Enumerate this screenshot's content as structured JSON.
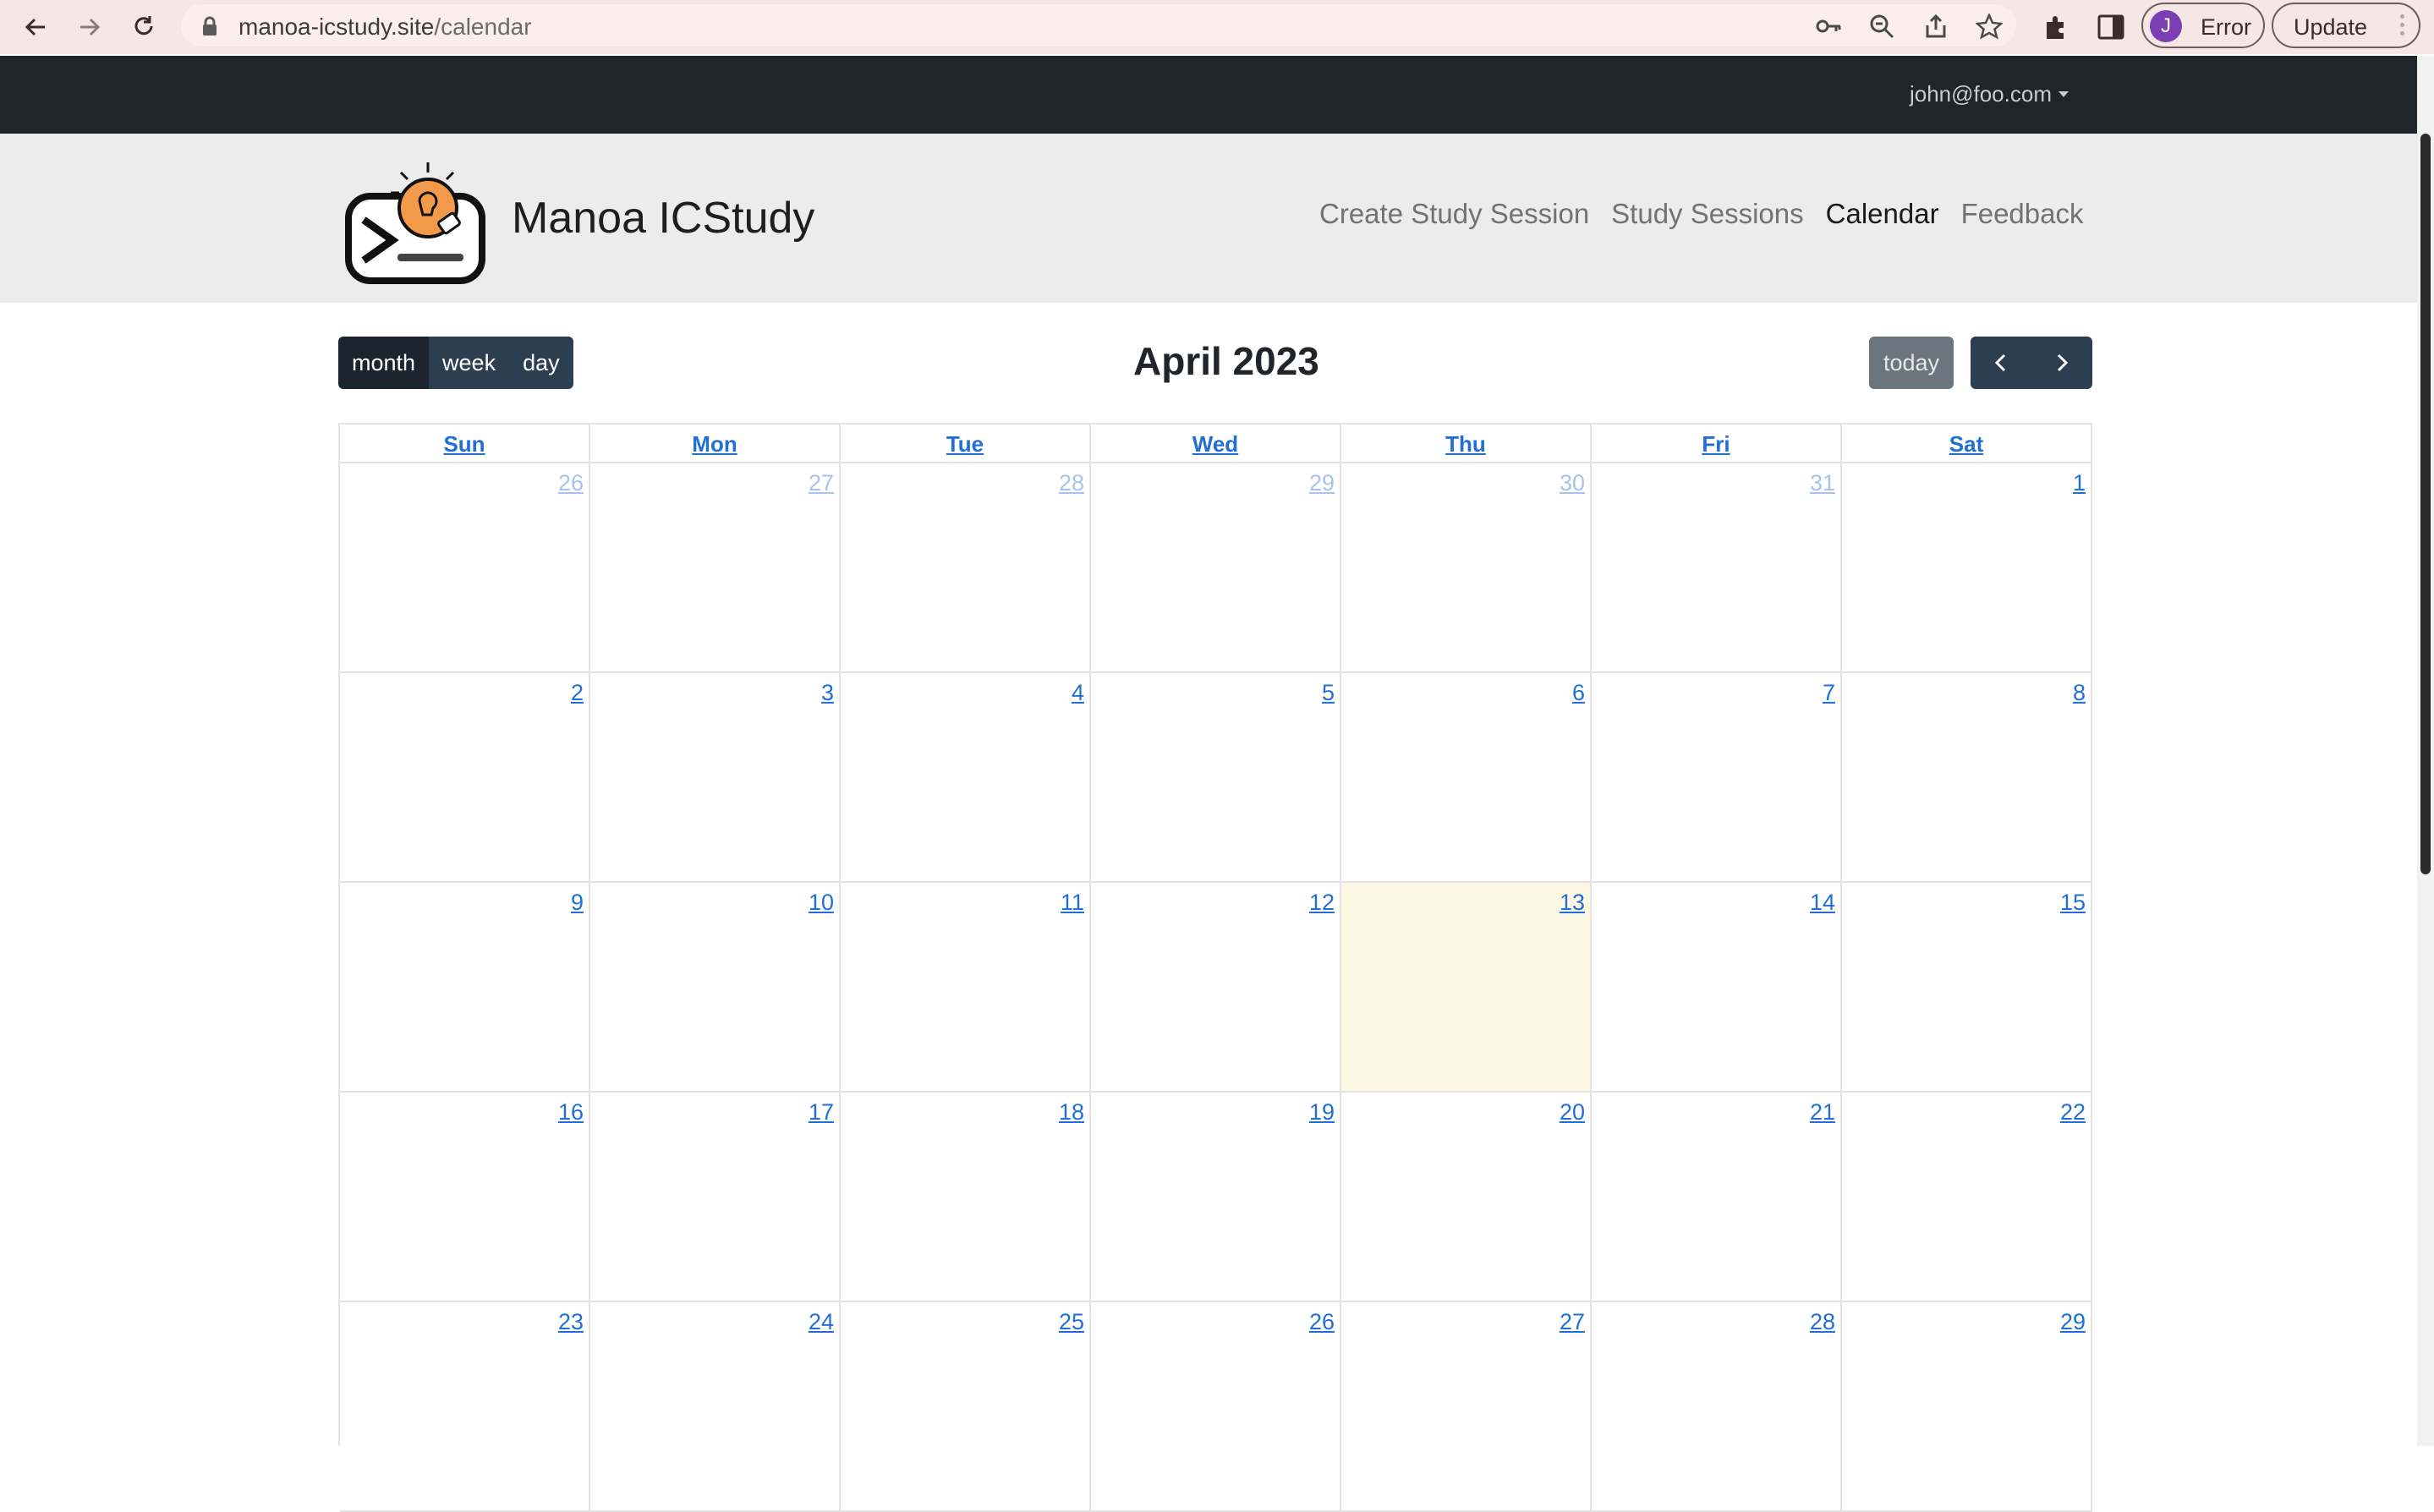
{
  "browser": {
    "url_host": "manoa-icstudy.site",
    "url_path": "/calendar",
    "profile_initial": "J",
    "profile_status": "Error",
    "update_label": "Update",
    "icons": [
      "back-arrow-icon",
      "forward-arrow-icon",
      "reload-icon",
      "lock-icon",
      "key-icon",
      "zoom-icon",
      "share-icon",
      "star-icon",
      "puzzle-icon",
      "side-panel-icon",
      "kebab-menu-icon"
    ]
  },
  "topbar": {
    "user_email": "john@foo.com"
  },
  "header": {
    "brand": "Manoa ICStudy",
    "nav": [
      {
        "label": "Create Study Session",
        "active": false
      },
      {
        "label": "Study Sessions",
        "active": false
      },
      {
        "label": "Calendar",
        "active": true
      },
      {
        "label": "Feedback",
        "active": false
      }
    ]
  },
  "calendar": {
    "title": "April 2023",
    "views": [
      "month",
      "week",
      "day"
    ],
    "active_view": "month",
    "today_label": "today",
    "weekdays": [
      "Sun",
      "Mon",
      "Tue",
      "Wed",
      "Thu",
      "Fri",
      "Sat"
    ],
    "weeks": [
      [
        "26",
        "27",
        "28",
        "29",
        "30",
        "31",
        "1"
      ],
      [
        "2",
        "3",
        "4",
        "5",
        "6",
        "7",
        "8"
      ],
      [
        "9",
        "10",
        "11",
        "12",
        "13",
        "14",
        "15"
      ],
      [
        "16",
        "17",
        "18",
        "19",
        "20",
        "21",
        "22"
      ],
      [
        "23",
        "24",
        "25",
        "26",
        "27",
        "28",
        "29"
      ]
    ],
    "other_month_cells": [
      [
        0,
        0
      ],
      [
        0,
        1
      ],
      [
        0,
        2
      ],
      [
        0,
        3
      ],
      [
        0,
        4
      ],
      [
        0,
        5
      ]
    ],
    "today_cell": [
      2,
      4
    ],
    "colors": {
      "link": "#1f6fd6",
      "today_bg": "#fcf8e3",
      "button": "#2c3e50"
    }
  }
}
